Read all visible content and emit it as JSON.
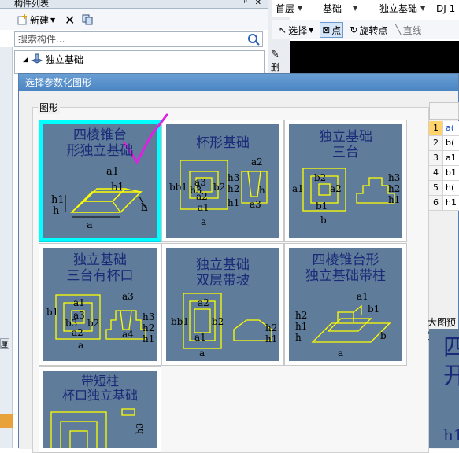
{
  "left_panel": {
    "title": "构件列表",
    "new_label": "新建",
    "search_placeholder": "搜索构件...",
    "tree_root": "独立基础"
  },
  "top_bar": {
    "floor": "首层",
    "category": "基础",
    "type": "独立基础",
    "item": "DJ-1"
  },
  "toolbar2": {
    "select": "选择",
    "point": "点",
    "rotate_point": "旋转点",
    "line": "直线"
  },
  "side_tool": "删",
  "left_marks": {
    "a": "厘"
  },
  "dialog": {
    "title": "选择参数化图形",
    "group_label": "图形",
    "tiles": [
      {
        "caption": [
          "四棱锥台",
          "形独立基础"
        ],
        "selected": true,
        "labels": [
          "a1",
          "b1",
          "h1",
          "h",
          "a",
          "b"
        ]
      },
      {
        "caption": [
          "杯形基础"
        ],
        "selected": false,
        "labels": [
          "a2",
          "a3",
          "bb1",
          "b3",
          "b2",
          "a2",
          "a1",
          "h3",
          "h2",
          "h1",
          "h",
          "a3",
          "a"
        ]
      },
      {
        "caption": [
          "独立基础",
          "三台"
        ],
        "selected": false,
        "labels": [
          "a1",
          "a",
          "b2",
          "a2",
          "b1",
          "b",
          "h3",
          "h2",
          "h1"
        ]
      },
      {
        "caption": [
          "独立基础",
          "三台有杯口"
        ],
        "selected": false,
        "labels": [
          "a3",
          "a1",
          "b1",
          "a3",
          "b3",
          "b2",
          "a2",
          "a4",
          "h3",
          "h2",
          "h1",
          "a"
        ]
      },
      {
        "caption": [
          "独立基础",
          "双层带坡"
        ],
        "selected": false,
        "labels": [
          "a2",
          "bb1",
          "b2",
          "a1",
          "a",
          "h2",
          "h1"
        ]
      },
      {
        "caption": [
          "四棱锥台形",
          "独立基础带柱"
        ],
        "selected": false,
        "labels": [
          "a1",
          "h2",
          "h1",
          "h",
          "b1",
          "b",
          "a"
        ]
      },
      {
        "caption": [
          "带短柱",
          "杯口独立基础"
        ],
        "selected": false,
        "labels": [
          "h3"
        ]
      }
    ]
  },
  "param_table": {
    "rows": [
      {
        "n": "1",
        "v": "a(",
        "selected": true
      },
      {
        "n": "2",
        "v": "b(",
        "selected": false
      },
      {
        "n": "3",
        "v": "a1",
        "selected": false
      },
      {
        "n": "4",
        "v": "b1",
        "selected": false
      },
      {
        "n": "5",
        "v": "h(",
        "selected": false
      },
      {
        "n": "6",
        "v": "h1",
        "selected": false
      }
    ]
  },
  "preview": {
    "label": "大图预览",
    "glyphs": [
      "四",
      "开"
    ],
    "bottom_label": "h1"
  }
}
